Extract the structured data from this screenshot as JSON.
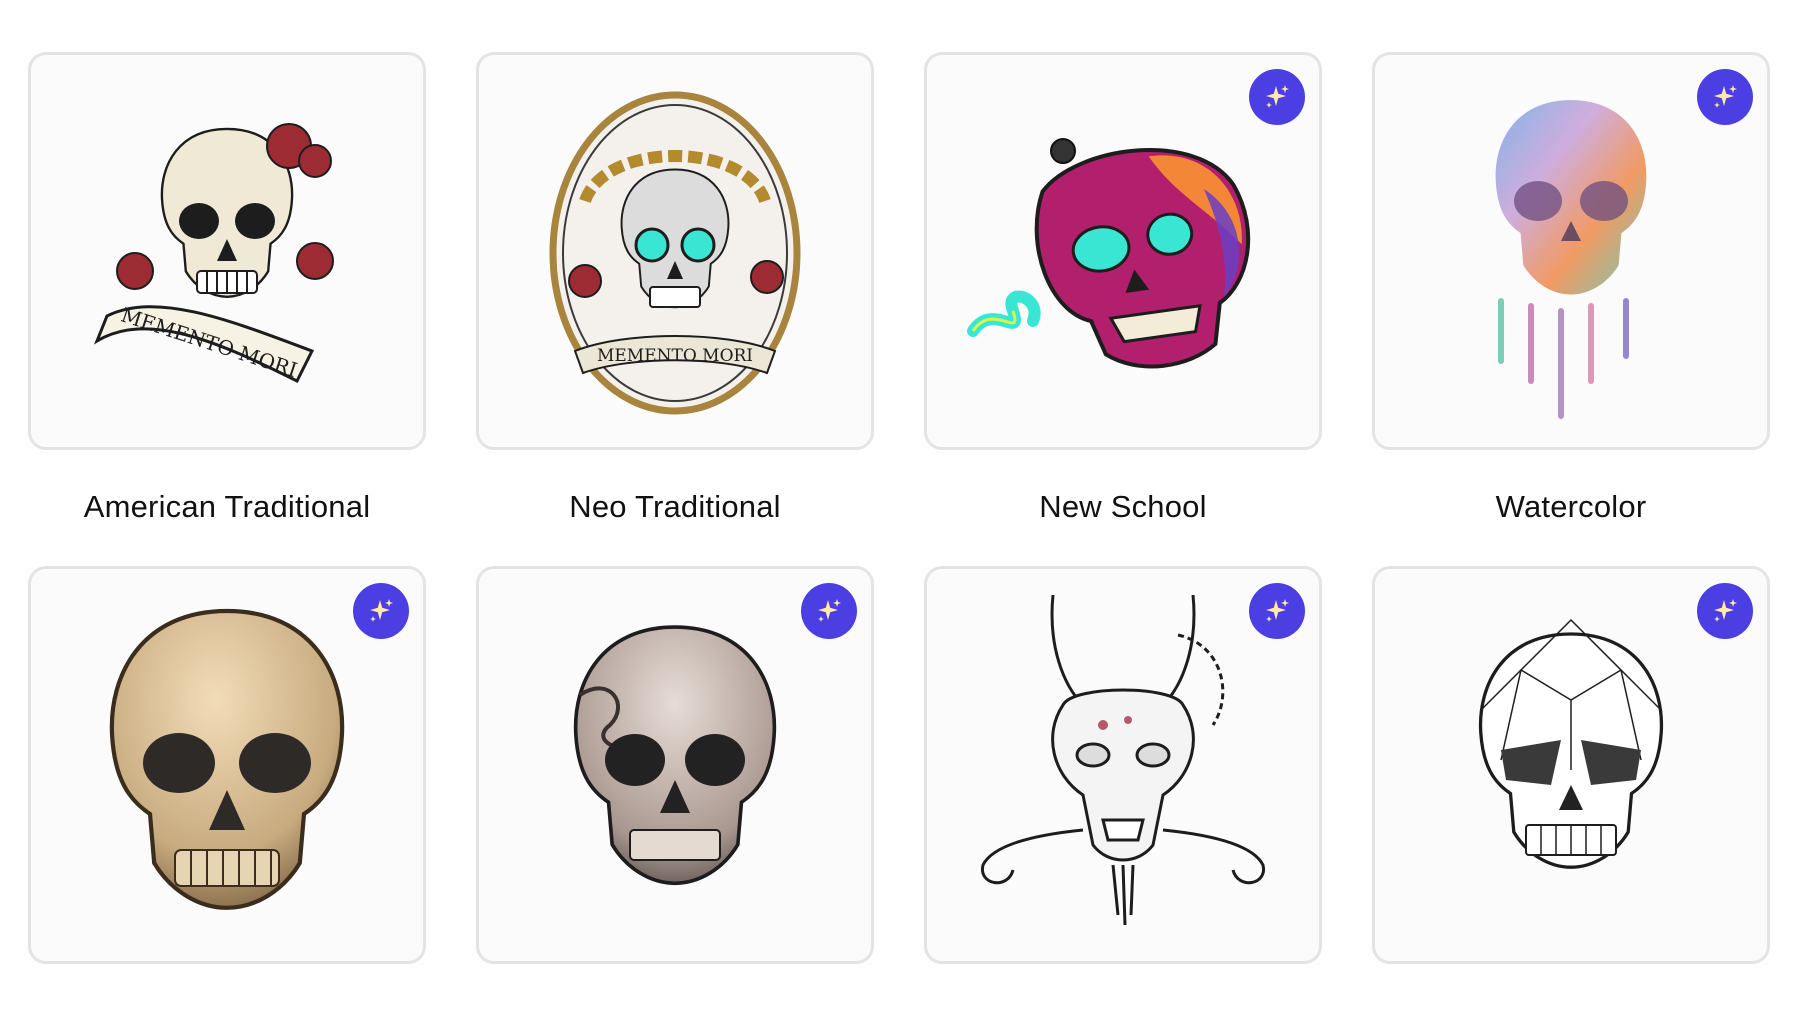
{
  "gallery": {
    "cards": [
      {
        "label": "American Traditional",
        "ai_badge": false,
        "icon": "skull-roses-banner-icon"
      },
      {
        "label": "Neo Traditional",
        "ai_badge": false,
        "icon": "skull-laurel-oval-icon"
      },
      {
        "label": "New School",
        "ai_badge": true,
        "icon": "neon-skull-icon"
      },
      {
        "label": "Watercolor",
        "ai_badge": true,
        "icon": "watercolor-skull-icon"
      },
      {
        "label": "",
        "ai_badge": true,
        "icon": "realistic-skull-icon"
      },
      {
        "label": "",
        "ai_badge": true,
        "icon": "blackwork-skull-icon"
      },
      {
        "label": "",
        "ai_badge": true,
        "icon": "dragon-skull-icon"
      },
      {
        "label": "",
        "ai_badge": true,
        "icon": "geometric-skull-icon"
      }
    ],
    "banner_text": {
      "card1": "MEMENTO MORI",
      "card2": "MEMENTO MORI"
    }
  },
  "colors": {
    "ai_badge": "#4b3fe4",
    "card_border": "#e4e4e4",
    "rose": "#9c2b33",
    "neon_cyan": "#39e6d3",
    "neon_magenta": "#b21f6c"
  }
}
